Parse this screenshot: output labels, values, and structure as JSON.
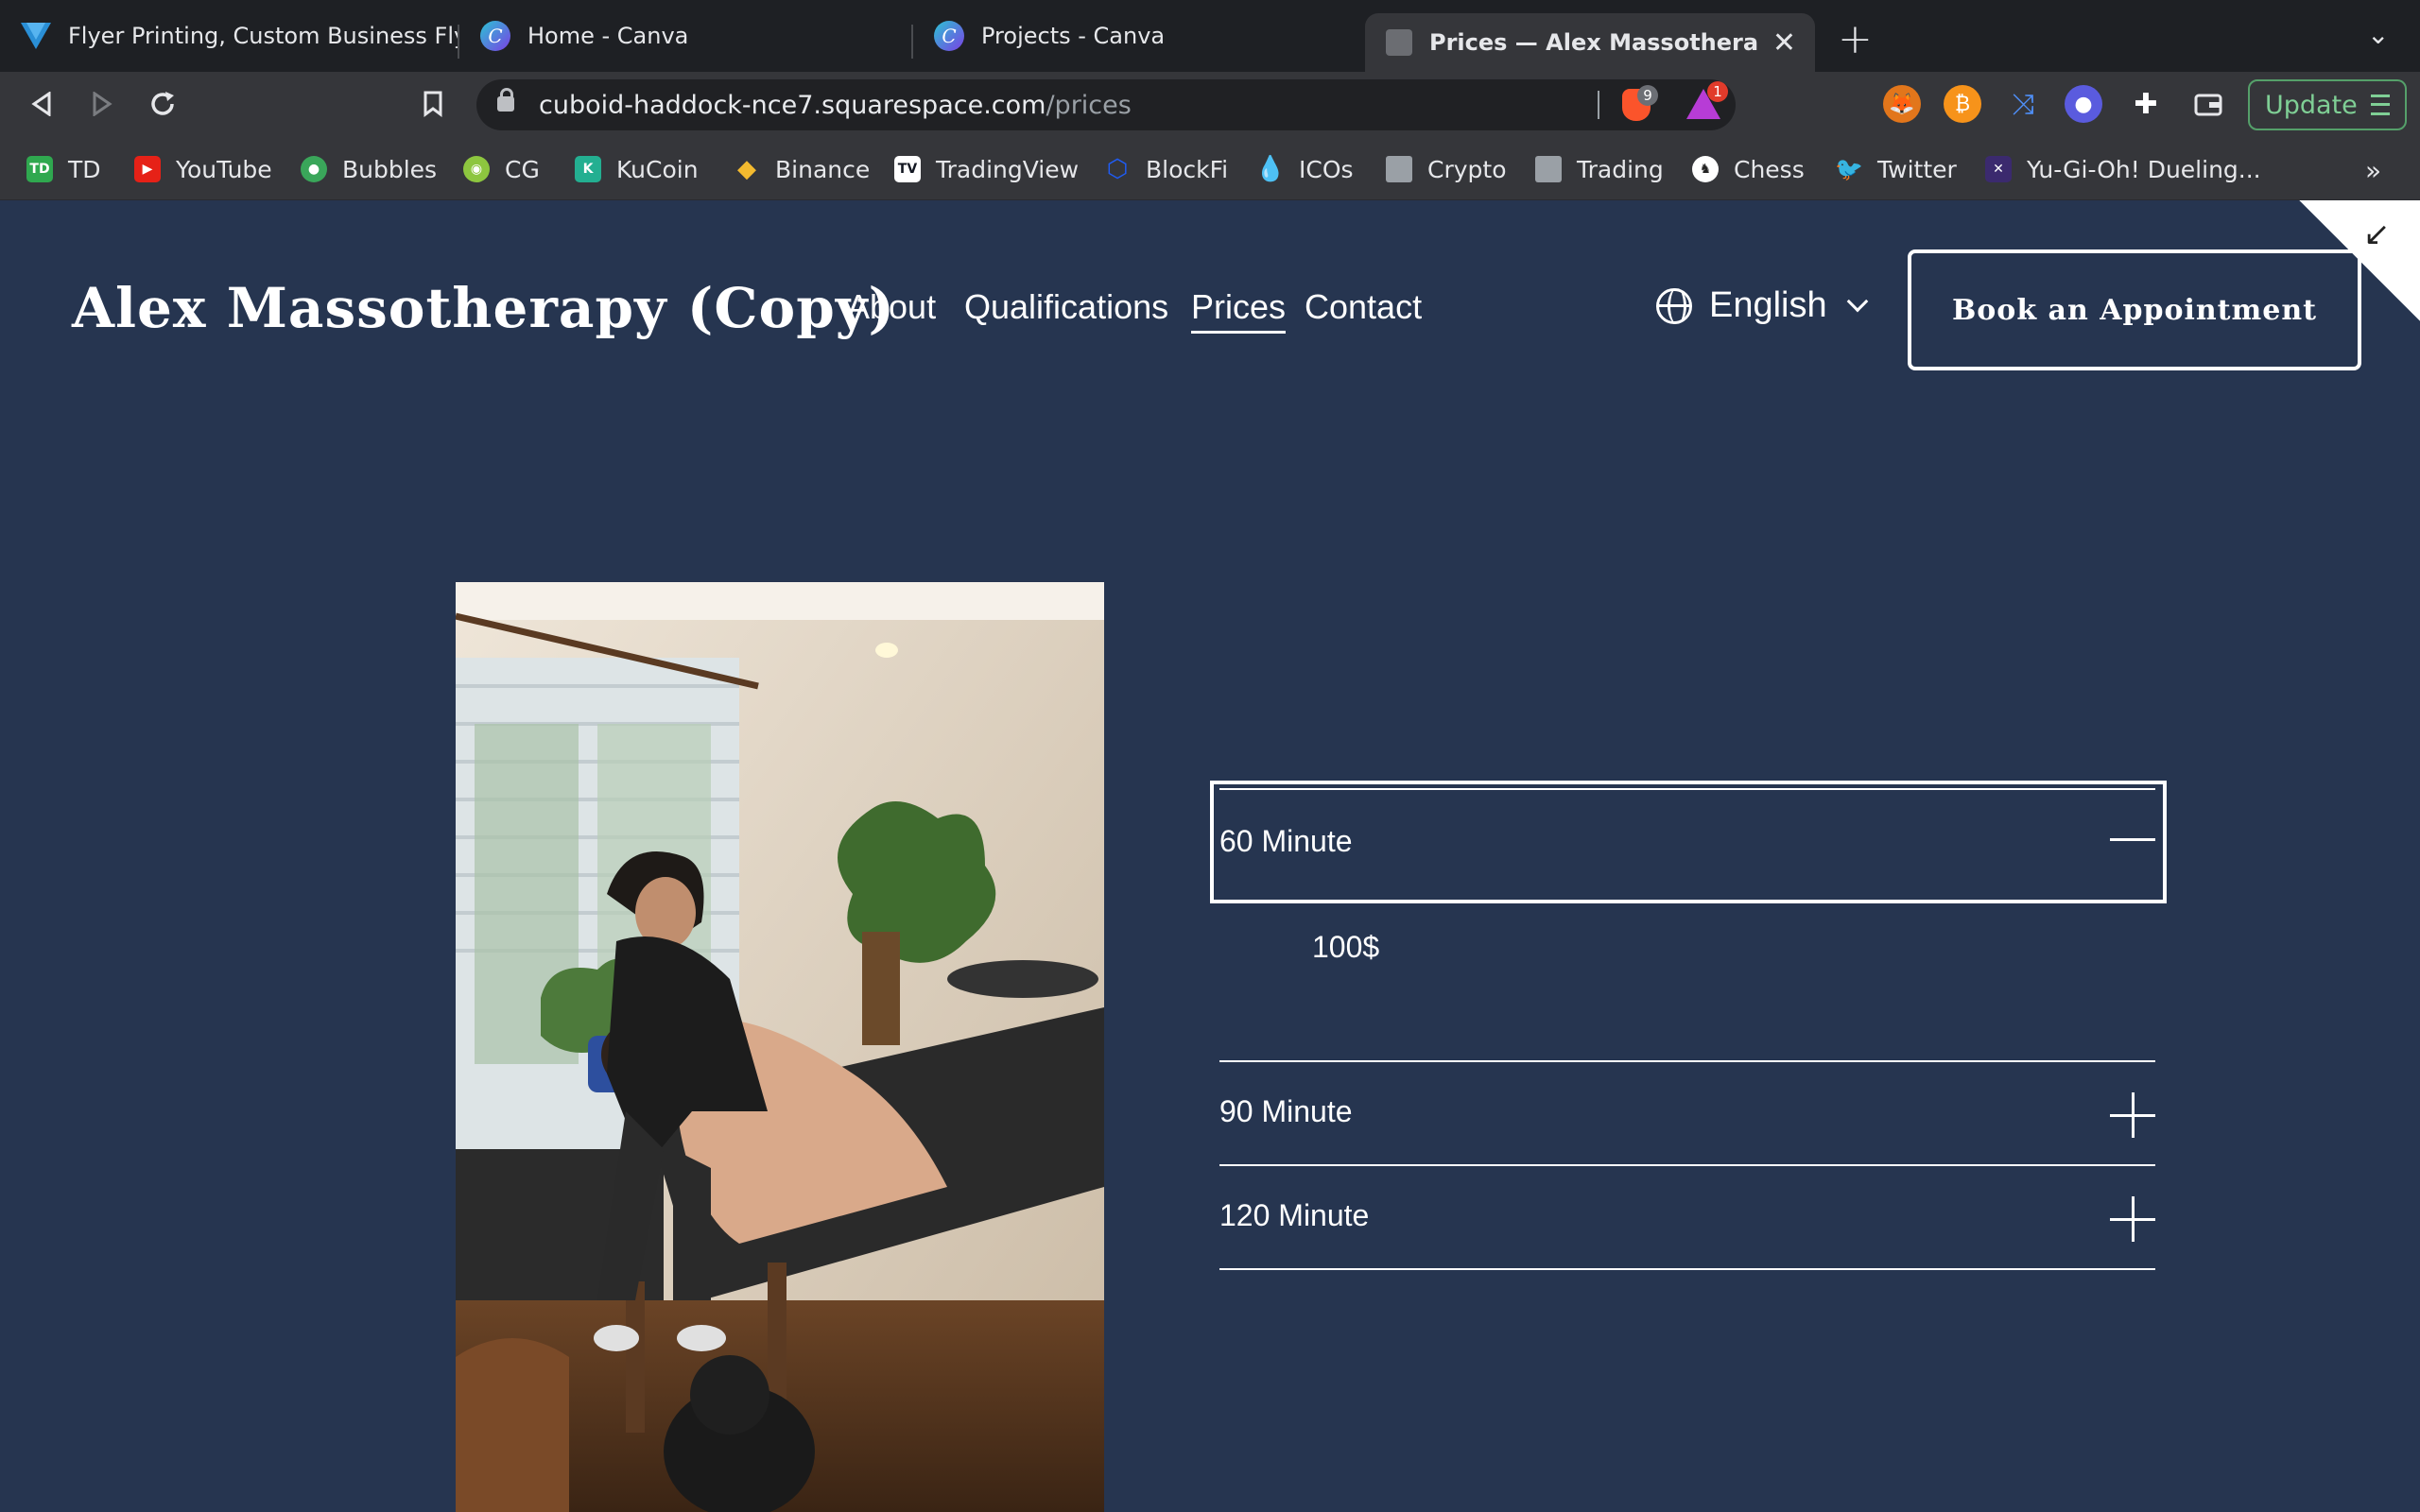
{
  "browser": {
    "tabs": [
      {
        "title": "Flyer Printing, Custom Business Flye",
        "icon": "vistaprint-icon",
        "active": false
      },
      {
        "title": "Home - Canva",
        "icon": "canva-icon",
        "active": false
      },
      {
        "title": "Projects - Canva",
        "icon": "canva-icon",
        "active": false
      },
      {
        "title": "Prices — Alex Massotherapy (C",
        "icon": "squarespace-icon",
        "active": true
      }
    ],
    "address": {
      "host": "cuboid-haddock-nce7.squarespace.com",
      "path": "/prices"
    },
    "brave_shield_count": "9",
    "rewards_count": "1",
    "update_label": "Update",
    "bookmarks": [
      {
        "label": "TD",
        "icon": "td-icon"
      },
      {
        "label": "YouTube",
        "icon": "youtube-icon"
      },
      {
        "label": "Bubbles",
        "icon": "bubbles-icon"
      },
      {
        "label": "CG",
        "icon": "coingecko-icon"
      },
      {
        "label": "KuCoin",
        "icon": "kucoin-icon"
      },
      {
        "label": "Binance",
        "icon": "binance-icon"
      },
      {
        "label": "TradingView",
        "icon": "tradingview-icon"
      },
      {
        "label": "BlockFi",
        "icon": "blockfi-icon"
      },
      {
        "label": "ICOs",
        "icon": "drop-icon"
      },
      {
        "label": "Crypto",
        "icon": "folder-icon"
      },
      {
        "label": "Trading",
        "icon": "folder-icon"
      },
      {
        "label": "Chess",
        "icon": "chess-icon"
      },
      {
        "label": "Twitter",
        "icon": "twitter-icon"
      },
      {
        "label": "Yu-Gi-Oh! Dueling...",
        "icon": "yugioh-icon"
      }
    ]
  },
  "site": {
    "title": "Alex Massotherapy (Copy)",
    "nav": [
      {
        "label": "About",
        "active": false
      },
      {
        "label": "Qualifications",
        "active": false
      },
      {
        "label": "Prices",
        "active": true
      },
      {
        "label": "Contact",
        "active": false
      }
    ],
    "language": "English",
    "cta": "Book an Appointment"
  },
  "pricing": {
    "items": [
      {
        "title": "60 Minute",
        "expanded": true,
        "price": "100$"
      },
      {
        "title": "90 Minute",
        "expanded": false
      },
      {
        "title": "120 Minute",
        "expanded": false
      }
    ]
  },
  "colors": {
    "page_bg": "#263550",
    "text": "#ffffff",
    "tabbar_bg": "#1e2024",
    "toolbar_bg": "#35363a",
    "update_green": "#7fcf95"
  }
}
